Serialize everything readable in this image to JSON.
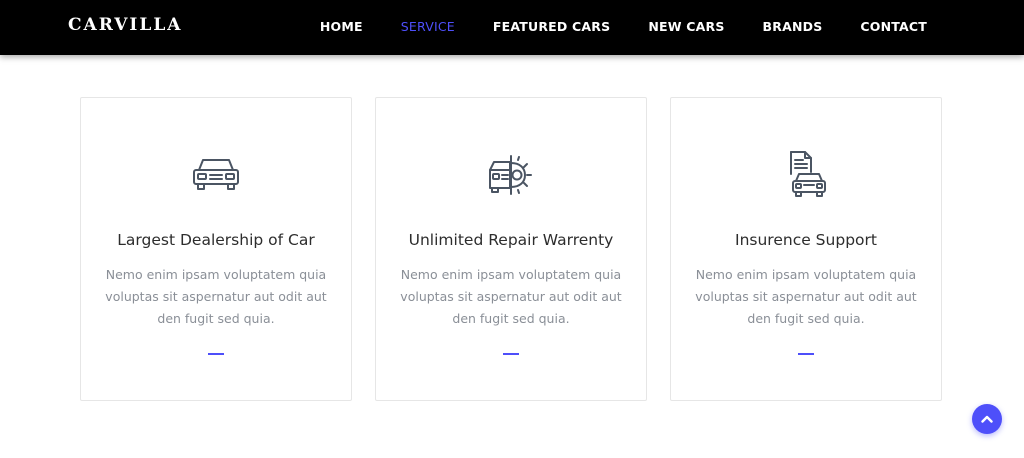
{
  "header": {
    "brand": "CARVILLA",
    "nav": [
      {
        "label": "HOME",
        "active": false
      },
      {
        "label": "SERVICE",
        "active": true
      },
      {
        "label": "FEATURED CARS",
        "active": false
      },
      {
        "label": "NEW CARS",
        "active": false
      },
      {
        "label": "BRANDS",
        "active": false
      },
      {
        "label": "CONTACT",
        "active": false
      }
    ]
  },
  "services": [
    {
      "icon": "car-icon",
      "title": "Largest Dealership of Car",
      "text": "Nemo enim ipsam voluptatem quia voluptas sit aspernatur aut odit aut den fugit sed quia."
    },
    {
      "icon": "car-repair-icon",
      "title": "Unlimited Repair Warrenty",
      "text": "Nemo enim ipsam voluptatem quia voluptas sit aspernatur aut odit aut den fugit sed quia."
    },
    {
      "icon": "car-insurance-icon",
      "title": "Insurence Support",
      "text": "Nemo enim ipsam voluptatem quia voluptas sit aspernatur aut odit aut den fugit sed quia."
    }
  ],
  "scroll_top": {
    "icon": "chevron-up-icon"
  },
  "colors": {
    "accent": "#4e4ffa",
    "navbar_bg": "#000000",
    "icon_stroke": "#4b5563"
  }
}
